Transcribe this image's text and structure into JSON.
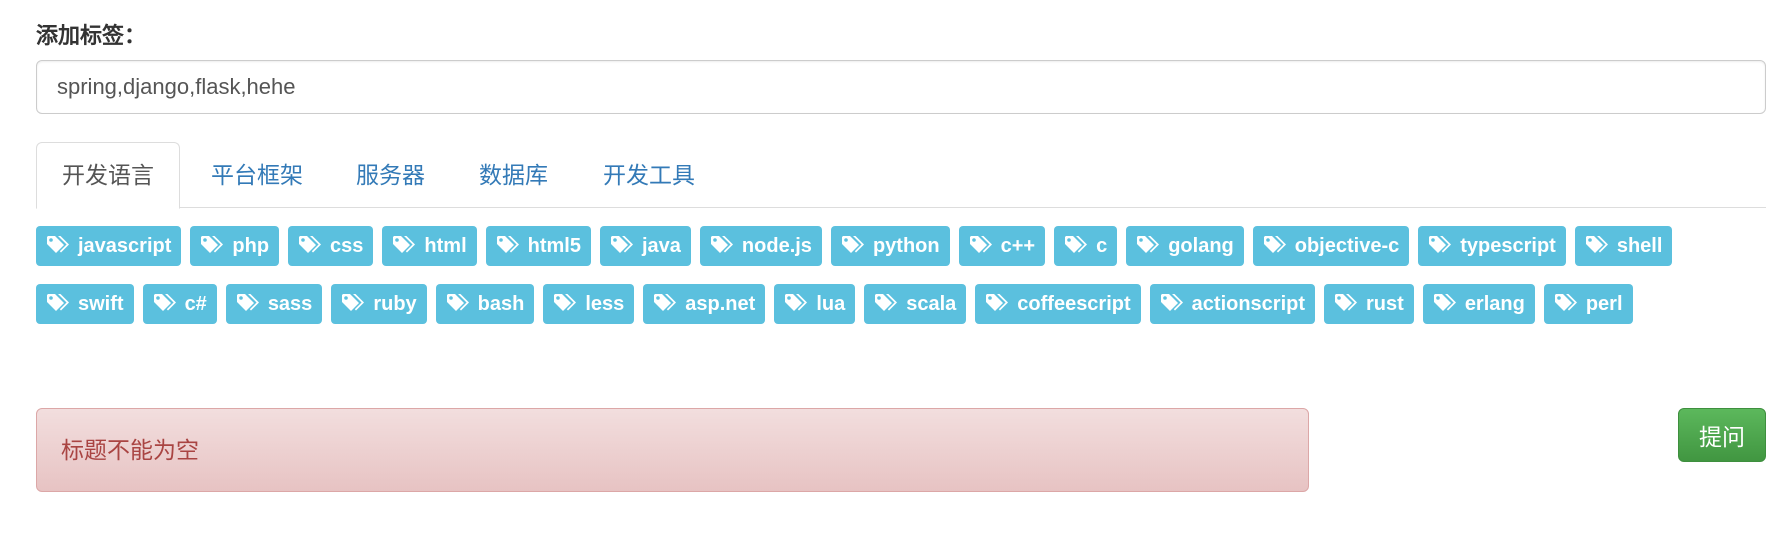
{
  "form": {
    "label": "添加标签：",
    "tags_value": "spring,django,flask,hehe"
  },
  "tabs": [
    {
      "label": "开发语言",
      "active": true
    },
    {
      "label": "平台框架",
      "active": false
    },
    {
      "label": "服务器",
      "active": false
    },
    {
      "label": "数据库",
      "active": false
    },
    {
      "label": "开发工具",
      "active": false
    }
  ],
  "tags": [
    "javascript",
    "php",
    "css",
    "html",
    "html5",
    "java",
    "node.js",
    "python",
    "c++",
    "c",
    "golang",
    "objective-c",
    "typescript",
    "shell",
    "swift",
    "c#",
    "sass",
    "ruby",
    "bash",
    "less",
    "asp.net",
    "lua",
    "scala",
    "coffeescript",
    "actionscript",
    "rust",
    "erlang",
    "perl"
  ],
  "tag_icon": "tags-icon",
  "alert": {
    "message": "标题不能为空"
  },
  "submit": {
    "label": "提问"
  },
  "colors": {
    "tag_bg": "#5bc0de",
    "alert_text": "#a94442",
    "alert_bg": "#f2dede",
    "submit_bg": "#5cb85c",
    "tab_link": "#337ab7"
  }
}
